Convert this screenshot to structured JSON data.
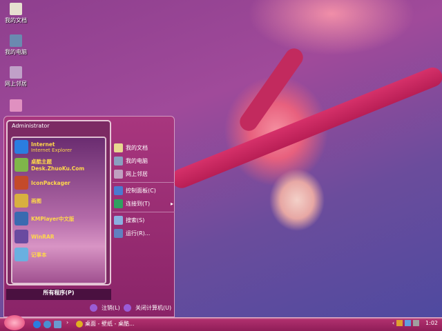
{
  "desktop": {
    "icons": [
      {
        "label": "我的文档",
        "icon": "my-documents-icon"
      },
      {
        "label": "我的电脑",
        "icon": "my-computer-icon"
      },
      {
        "label": "网上邻居",
        "icon": "network-icon"
      },
      {
        "label": "",
        "icon": "recycle-bin-icon"
      }
    ]
  },
  "start_menu": {
    "user": "Administrator",
    "programs": [
      {
        "label": "Internet",
        "sub": "Internet Explorer",
        "icon": "ie-icon",
        "color": "#2b7de0"
      },
      {
        "label": "桌酷主题Desk.ZhuoKu.Com",
        "icon": "zhuoku-icon",
        "color": "#7fb64a"
      },
      {
        "label": "IconPackager",
        "icon": "iconpackager-icon",
        "color": "#c44a2a"
      },
      {
        "label": "画图",
        "icon": "paint-icon",
        "color": "#d8b040"
      },
      {
        "label": "KMPlayer中文版",
        "icon": "kmplayer-icon",
        "color": "#3a6ab0"
      },
      {
        "label": "WinRAR",
        "icon": "winrar-icon",
        "color": "#6a4aa0"
      },
      {
        "label": "记事本",
        "icon": "notepad-icon",
        "color": "#6ab0e0"
      }
    ],
    "all_programs": "所有程序(P)",
    "places": [
      {
        "label": "我的文档",
        "icon": "my-documents-icon",
        "color": "#e8d890"
      },
      {
        "label": "我的电脑",
        "icon": "my-computer-icon",
        "color": "#8aa0c0"
      },
      {
        "label": "网上邻居",
        "icon": "network-icon",
        "color": "#c0a0c0"
      }
    ],
    "settings": [
      {
        "label": "控制面板(C)",
        "icon": "control-panel-icon",
        "color": "#4a7ad0"
      },
      {
        "label": "连接到(T)",
        "icon": "connect-icon",
        "color": "#30a060",
        "submenu": "▸"
      }
    ],
    "tools": [
      {
        "label": "搜索(S)",
        "icon": "search-icon",
        "color": "#8ab0e0"
      },
      {
        "label": "运行(R)...",
        "icon": "run-icon",
        "color": "#6080c0"
      }
    ],
    "logoff": "注销(L)",
    "shutdown": "关闭计算机(U)"
  },
  "taskbar": {
    "quick_launch_more": "›",
    "task": "桌面 - 壁纸 - 桌酷...",
    "tray_expand": "‹",
    "clock": "1:02"
  }
}
